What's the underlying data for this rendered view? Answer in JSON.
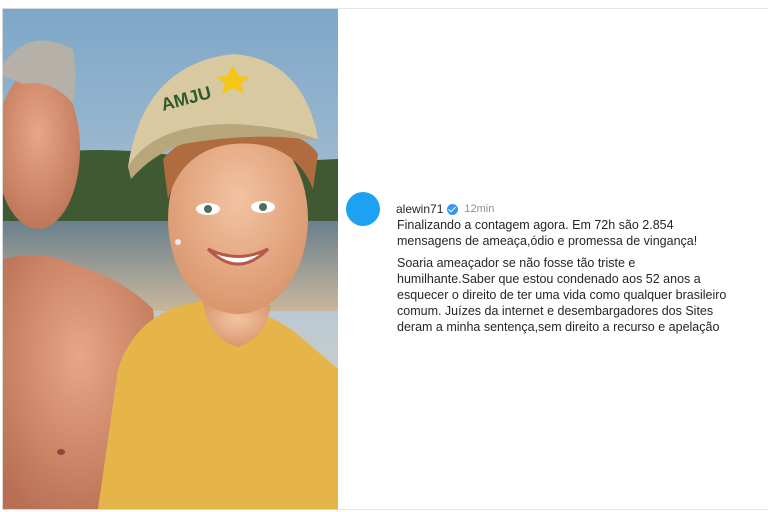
{
  "post": {
    "username": "alewin71",
    "timestamp": "12min",
    "caption_para1": [
      "Finalizando a contagem agora. Em 72h são 2.854",
      "mensagens de ameaça,ódio e promessa de vingança!"
    ],
    "caption_para2": [
      "Soaria ameaçador se não fosse tão triste e",
      "humilhante.Saber que estou condenado aos 52 anos a",
      "esquecer o direito de ter uma vida como qualquer brasileiro",
      "comum. Juízes da internet e desembargadores dos Sites",
      "deram a minha sentença,sem direito a recurso e apelação"
    ]
  },
  "photo": {
    "cap_logo_text": "AMJU"
  },
  "colors": {
    "avatar": "#1da1f2",
    "verified": "#3897f0",
    "shirt": "#e9b94d",
    "cap": "#d8c9a0"
  }
}
